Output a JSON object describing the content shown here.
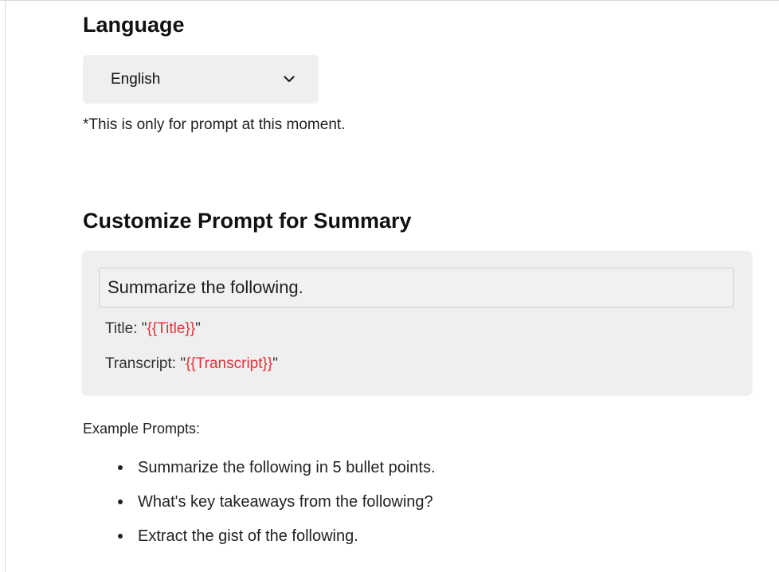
{
  "language": {
    "heading": "Language",
    "selected": "English",
    "chevron_icon": "chevron-down-icon",
    "note": "*This is only for prompt at this moment."
  },
  "prompt": {
    "heading": "Customize Prompt for Summary",
    "input_value": "Summarize the following.",
    "title_label": "Title: \"",
    "title_var": "{{Title}}",
    "transcript_label": "Transcript: \"",
    "transcript_var": "{{Transcript}}",
    "quote_close": "\""
  },
  "examples": {
    "heading": "Example Prompts:",
    "items": [
      "Summarize the following in 5 bullet points.",
      "What's key takeaways from the following?",
      "Extract the gist of the following."
    ]
  },
  "colors": {
    "variable_token": "#e0333a",
    "panel_background": "#efefef"
  }
}
